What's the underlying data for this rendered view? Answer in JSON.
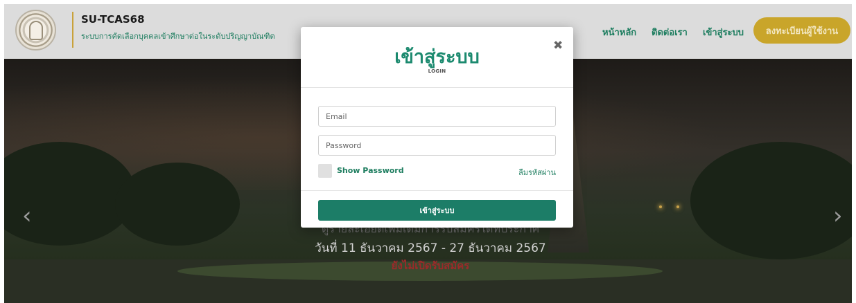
{
  "header": {
    "title": "SU-TCAS68",
    "subtitle": "ระบบการคัดเลือกบุคคลเข้าศึกษาต่อในระดับปริญญาบัณฑิต",
    "nav": [
      "หน้าหลัก",
      "ติดต่อเรา",
      "เข้าสู่ระบบ"
    ],
    "register_label": "ลงทะเบียนผู้ใช้งาน"
  },
  "hero": {
    "caption_partial": "ดูรายละเอียดเพิ่มเติมการรับสมัครได้ที่ประกาศ",
    "dates": "วันที่ 11 ธันวาคม 2567 - 27 ธันวาคม 2567",
    "status": "ยังไม่เปิดรับสมัคร",
    "prev_icon": "chevron-left-icon",
    "next_icon": "chevron-right-icon"
  },
  "modal": {
    "title": "เข้าสู่ระบบ",
    "subtitle": "LOGIN",
    "close_icon": "close-icon",
    "email_placeholder": "Email",
    "password_placeholder": "Password",
    "show_password_label": "Show Password",
    "forgot_label": "ลืมรหัสผ่าน",
    "submit_label": "เข้าสู่ระบบ"
  },
  "colors": {
    "brand_green": "#1d7d5f",
    "register_gold": "#c9a52a",
    "status_red": "#9b2a2a"
  }
}
